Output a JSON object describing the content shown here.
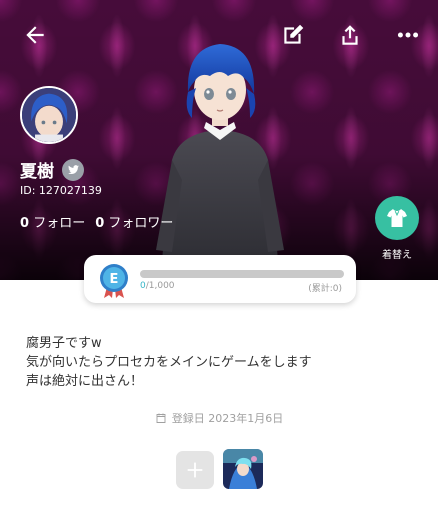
{
  "header": {
    "back_icon": "back-arrow-icon",
    "edit_icon": "edit-icon",
    "share_icon": "share-icon",
    "more_icon": "more-icon"
  },
  "profile": {
    "username": "夏樹",
    "user_id": "ID: 127027139",
    "following_count": "0",
    "following_label": "フォロー",
    "followers_count": "0",
    "followers_label": "フォロワー",
    "linked_icon": "twitter-icon"
  },
  "wardrobe": {
    "label": "着替え",
    "icon": "shirt-icon"
  },
  "level": {
    "badge_letter": "E",
    "current": "0",
    "max": "/1,000",
    "total": "(累計:0)",
    "progress_fraction": 0.0
  },
  "bio": {
    "text": "腐男子ですw\n気が向いたらプロセカをメインにゲームをします\n声は絶対に出さん！"
  },
  "registration": {
    "label": "登録日 2023年1月6日"
  },
  "colors": {
    "accent": "#37c0a2",
    "progress": "#37c0d0",
    "cover": "#4a0d3d"
  }
}
